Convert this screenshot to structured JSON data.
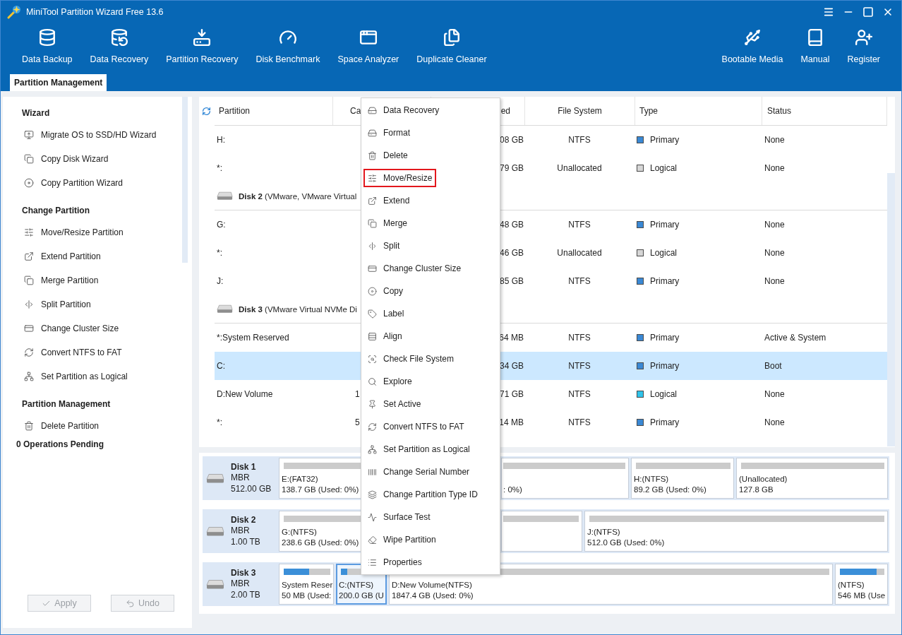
{
  "window": {
    "title": "MiniTool Partition Wizard Free 13.6"
  },
  "toolbar": {
    "left": [
      "Data Backup",
      "Data Recovery",
      "Partition Recovery",
      "Disk Benchmark",
      "Space Analyzer",
      "Duplicate Cleaner"
    ],
    "right": [
      "Bootable Media",
      "Manual",
      "Register"
    ]
  },
  "tabs": [
    {
      "label": "Partition Management",
      "selected": true
    }
  ],
  "sidebar": {
    "sections": [
      {
        "title": "Wizard",
        "items": [
          "Migrate OS to SSD/HD Wizard",
          "Copy Disk Wizard",
          "Copy Partition Wizard"
        ]
      },
      {
        "title": "Change Partition",
        "items": [
          "Move/Resize Partition",
          "Extend Partition",
          "Merge Partition",
          "Split Partition",
          "Change Cluster Size",
          "Convert NTFS to FAT",
          "Set Partition as Logical"
        ]
      },
      {
        "title": "Partition Management",
        "items": [
          "Delete Partition"
        ]
      }
    ],
    "pending": "0 Operations Pending",
    "buttons": [
      {
        "label": "Apply",
        "disabled": true
      },
      {
        "label": "Undo",
        "disabled": true
      }
    ]
  },
  "table": {
    "columns": [
      "Partition",
      "Ca",
      "ed",
      "File System",
      "Type",
      "Status"
    ],
    "rows": [
      {
        "kind": "partition",
        "partition": "H:",
        "column_3": "08 GB",
        "file_system": "NTFS",
        "type": "Primary",
        "color": "#3a88d4",
        "status": "None",
        "selected": false
      },
      {
        "kind": "partition",
        "partition": "*:",
        "column_3": "79 GB",
        "file_system": "Unallocated",
        "type": "Logical",
        "color": "#d6d6d6",
        "status": "None",
        "selected": false
      },
      {
        "kind": "disk",
        "title": "**Disk 2** (VMware, VMware Virtual"
      },
      {
        "kind": "partition",
        "partition": "G:",
        "column_3": "48 GB",
        "file_system": "NTFS",
        "type": "Primary",
        "color": "#3a88d4",
        "status": "None",
        "selected": false
      },
      {
        "kind": "partition",
        "partition": "*:",
        "column_3": "46 GB",
        "file_system": "Unallocated",
        "type": "Logical",
        "color": "#d6d6d6",
        "status": "None",
        "selected": false
      },
      {
        "kind": "partition",
        "partition": "J:",
        "column_3": "85 GB",
        "file_system": "NTFS",
        "type": "Primary",
        "color": "#3a88d4",
        "status": "None",
        "selected": false
      },
      {
        "kind": "disk",
        "title": "**Disk 3** (VMware Virtual NVMe Di"
      },
      {
        "kind": "partition",
        "partition": "*:System Reserved",
        "column_3": "64 MB",
        "file_system": "NTFS",
        "type": "Primary",
        "color": "#3a88d4",
        "status": "Active & System",
        "selected": false
      },
      {
        "kind": "partition",
        "partition": "C:",
        "column_3": "34 GB",
        "file_system": "NTFS",
        "type": "Primary",
        "color": "#3a88d4",
        "status": "Boot",
        "selected": true
      },
      {
        "kind": "partition",
        "partition": "D:New Volume",
        "column_2": "1",
        "column_3": "71 GB",
        "file_system": "NTFS",
        "type": "Logical",
        "color": "#2fc3ea",
        "status": "None",
        "selected": false
      },
      {
        "kind": "partition",
        "partition": "*:",
        "column_2": "5",
        "column_3": "14 MB",
        "file_system": "NTFS",
        "type": "Primary",
        "color": "#3a88d4",
        "status": "None",
        "selected": false
      }
    ]
  },
  "context_menu": {
    "items": [
      {
        "label": "Data Recovery",
        "highlighted": false
      },
      {
        "label": "Format",
        "highlighted": false
      },
      {
        "label": "Delete",
        "highlighted": false
      },
      {
        "label": "Move/Resize",
        "highlighted": true
      },
      {
        "label": "Extend",
        "highlighted": false
      },
      {
        "label": "Merge",
        "highlighted": false
      },
      {
        "label": "Split",
        "highlighted": false
      },
      {
        "label": "Change Cluster Size",
        "highlighted": false
      },
      {
        "label": "Copy",
        "highlighted": false
      },
      {
        "label": "Label",
        "highlighted": false
      },
      {
        "label": "Align",
        "highlighted": false
      },
      {
        "label": "Check File System",
        "highlighted": false
      },
      {
        "label": "Explore",
        "highlighted": false
      },
      {
        "label": "Set Active",
        "highlighted": false
      },
      {
        "label": "Convert NTFS to FAT",
        "highlighted": false
      },
      {
        "label": "Set Partition as Logical",
        "highlighted": false
      },
      {
        "label": "Change Serial Number",
        "highlighted": false
      },
      {
        "label": "Change Partition Type ID",
        "highlighted": false
      },
      {
        "label": "Surface Test",
        "highlighted": false
      },
      {
        "label": "Wipe Partition",
        "highlighted": false
      },
      {
        "label": "Properties",
        "highlighted": false
      }
    ]
  },
  "disk_map": {
    "disks": [
      {
        "name": "Disk 1",
        "scheme": "MBR",
        "size": "512.00 GB",
        "partitions": [
          {
            "label": "E:(FAT32)",
            "detail": "138.7 GB (Used: 0%)",
            "selected": false
          },
          {
            "detail": ": 0%)",
            "selected": false
          },
          {
            "label": "H:(NTFS)",
            "detail": "89.2 GB (Used: 0%)",
            "selected": false
          },
          {
            "label": "(Unallocated)",
            "detail": "127.8 GB",
            "selected": false
          }
        ]
      },
      {
        "name": "Disk 2",
        "scheme": "MBR",
        "size": "1.00 TB",
        "partitions": [
          {
            "label": "G:(NTFS)",
            "detail": "238.6 GB (Used: 0%)",
            "selected": false
          },
          {
            "selected": false
          },
          {
            "label": "J:(NTFS)",
            "detail": "512.0 GB (Used: 0%)",
            "selected": false
          }
        ]
      },
      {
        "name": "Disk 3",
        "scheme": "MBR",
        "size": "2.00 TB",
        "partitions": [
          {
            "label": "System Reser",
            "detail": "50 MB (Used:",
            "level": 0.55,
            "selected": false
          },
          {
            "label": "C:(NTFS)",
            "detail": "200.0 GB (U",
            "level": 0.15,
            "selected": true
          },
          {
            "label": "D:New Volume(NTFS)",
            "detail": "1847.4 GB (Used: 0%)",
            "selected": false
          },
          {
            "label": "(NTFS)",
            "detail": "546 MB (Use",
            "level": 0.82,
            "selected": false
          }
        ]
      }
    ]
  }
}
